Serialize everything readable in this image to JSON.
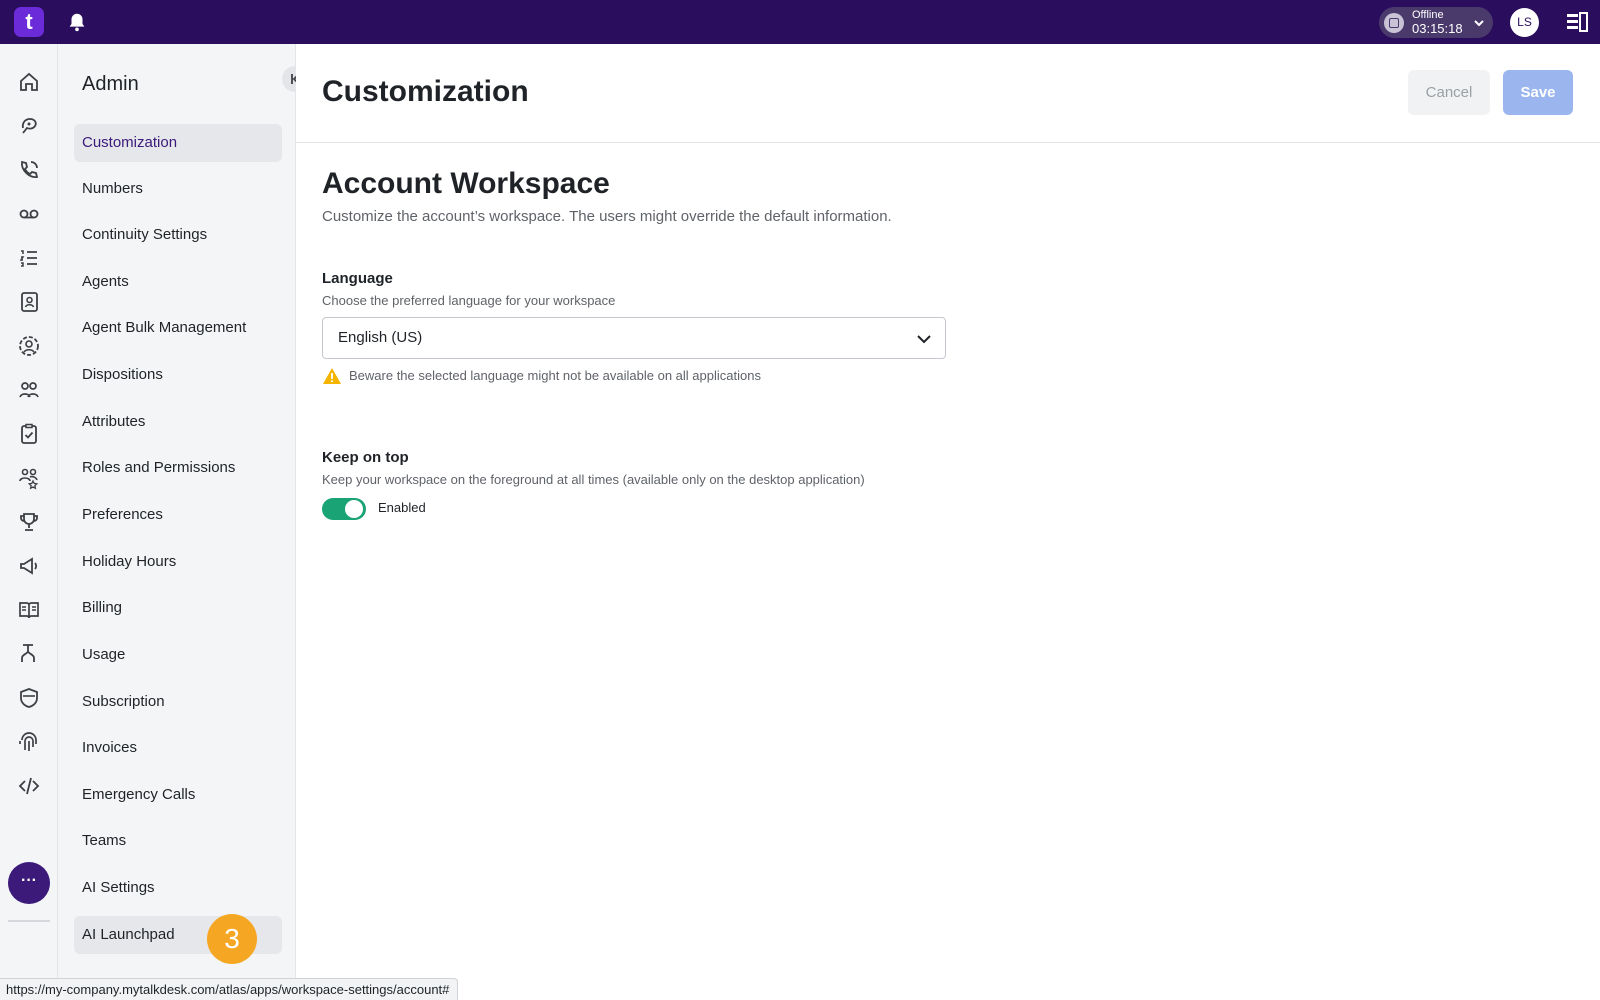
{
  "topbar": {
    "logo_text": "t",
    "status": {
      "label": "Offline",
      "time": "03:15:18"
    },
    "avatar_initials": "LS",
    "colors": {
      "background": "#2a0d5c",
      "logo": "#6c2bd9"
    }
  },
  "rail": {
    "icons": [
      "home-icon",
      "conversations-icon",
      "calls-icon",
      "voicemail-icon",
      "activities-icon",
      "contacts-icon",
      "live-icon",
      "supervisors-icon",
      "tasks-icon",
      "agents-performance-icon",
      "trophy-icon",
      "megaphone-icon",
      "knowledge-icon",
      "workflows-icon",
      "security-shield-icon",
      "fingerprint-icon",
      "code-icon"
    ],
    "more_label": "···"
  },
  "sidebar": {
    "title": "Admin",
    "items": [
      {
        "label": "Customization",
        "active": true
      },
      {
        "label": "Numbers"
      },
      {
        "label": "Continuity Settings"
      },
      {
        "label": "Agents"
      },
      {
        "label": "Agent Bulk Management"
      },
      {
        "label": "Dispositions"
      },
      {
        "label": "Attributes"
      },
      {
        "label": "Roles and Permissions"
      },
      {
        "label": "Preferences"
      },
      {
        "label": "Holiday Hours"
      },
      {
        "label": "Billing"
      },
      {
        "label": "Usage"
      },
      {
        "label": "Subscription"
      },
      {
        "label": "Invoices"
      },
      {
        "label": "Emergency Calls"
      },
      {
        "label": "Teams"
      },
      {
        "label": "AI Settings"
      },
      {
        "label": "AI Launchpad"
      }
    ]
  },
  "main": {
    "title": "Customization",
    "cancel_label": "Cancel",
    "save_label": "Save",
    "section": {
      "title": "Account Workspace",
      "description": "Customize the account’s workspace. The users might override the default information."
    },
    "language": {
      "label": "Language",
      "hint": "Choose the preferred language for your workspace",
      "selected": "English (US)",
      "warning": "Beware the selected language might not be available on all applications"
    },
    "keep_on_top": {
      "label": "Keep on top",
      "hint": "Keep your workspace on the foreground at all times (available only on the desktop application)",
      "toggle_label": "Enabled",
      "enabled": true
    },
    "colors": {
      "save": "#9bb6ef",
      "toggle": "#1aa374",
      "warning": "#f5b400"
    }
  },
  "overlay": {
    "step_badge": "3",
    "url": "https://my-company.mytalkdesk.com/atlas/apps/workspace-settings/account#"
  }
}
